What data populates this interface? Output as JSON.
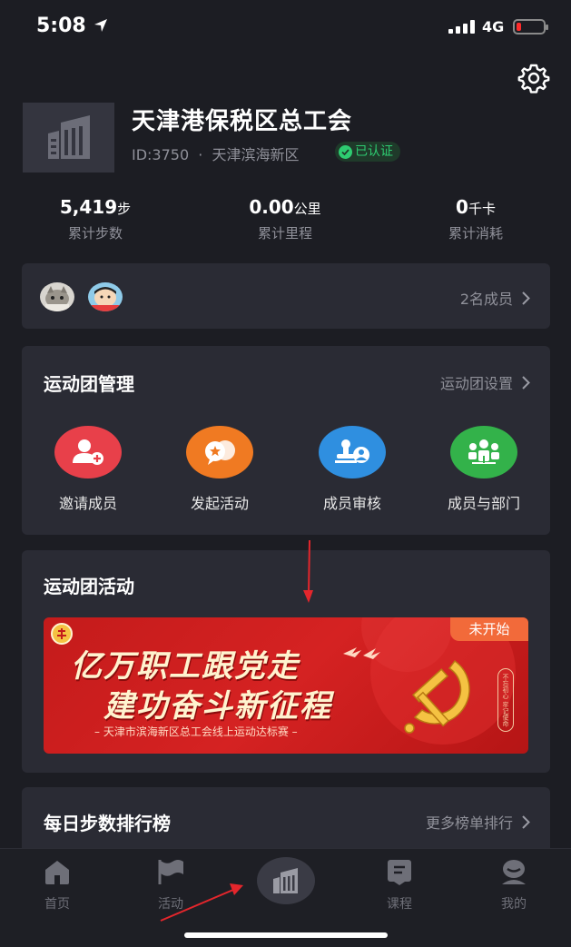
{
  "status_bar": {
    "time": "5:08",
    "network": "4G"
  },
  "org": {
    "name": "天津港保税区总工会",
    "id_text": "ID:3750",
    "separator": "·",
    "region": "天津滨海新区",
    "verified_label": "已认证"
  },
  "stats": [
    {
      "value": "5,419",
      "unit": "步",
      "label": "累计步数"
    },
    {
      "value": "0.00",
      "unit": "公里",
      "label": "累计里程"
    },
    {
      "value": "0",
      "unit": "千卡",
      "label": "累计消耗"
    }
  ],
  "members": {
    "count_label": "2名成员"
  },
  "management": {
    "title": "运动团管理",
    "settings_link": "运动团设置",
    "actions": [
      {
        "label": "邀请成员",
        "color": "#e8404a"
      },
      {
        "label": "发起活动",
        "color": "#f07a22"
      },
      {
        "label": "成员审核",
        "color": "#2f8fe0"
      },
      {
        "label": "成员与部门",
        "color": "#33b24a"
      }
    ]
  },
  "activities": {
    "title": "运动团活动",
    "banner": {
      "status": "未开始",
      "line1": "亿万职工跟党走",
      "line2": "建功奋斗新征程",
      "subtitle": "– 天津市滨海新区总工会线上运动达标赛 –",
      "vertical_text": "不忘初心 牢记使命"
    }
  },
  "ranking": {
    "title": "每日步数排行榜",
    "more_link": "更多榜单排行"
  },
  "tabbar": {
    "tabs": [
      {
        "label": "首页",
        "icon": "home-icon"
      },
      {
        "label": "活动",
        "icon": "flag-icon"
      },
      {
        "label": "",
        "icon": "building-icon"
      },
      {
        "label": "课程",
        "icon": "book-icon"
      },
      {
        "label": "我的",
        "icon": "profile-icon"
      }
    ]
  },
  "colors": {
    "background": "#1c1d23",
    "card": "#2a2b34",
    "verified_green": "#2ecc71",
    "banner_red": "#c41b1b",
    "banner_status_orange": "#f26a3a",
    "annotation_arrow": "#e4262c"
  }
}
